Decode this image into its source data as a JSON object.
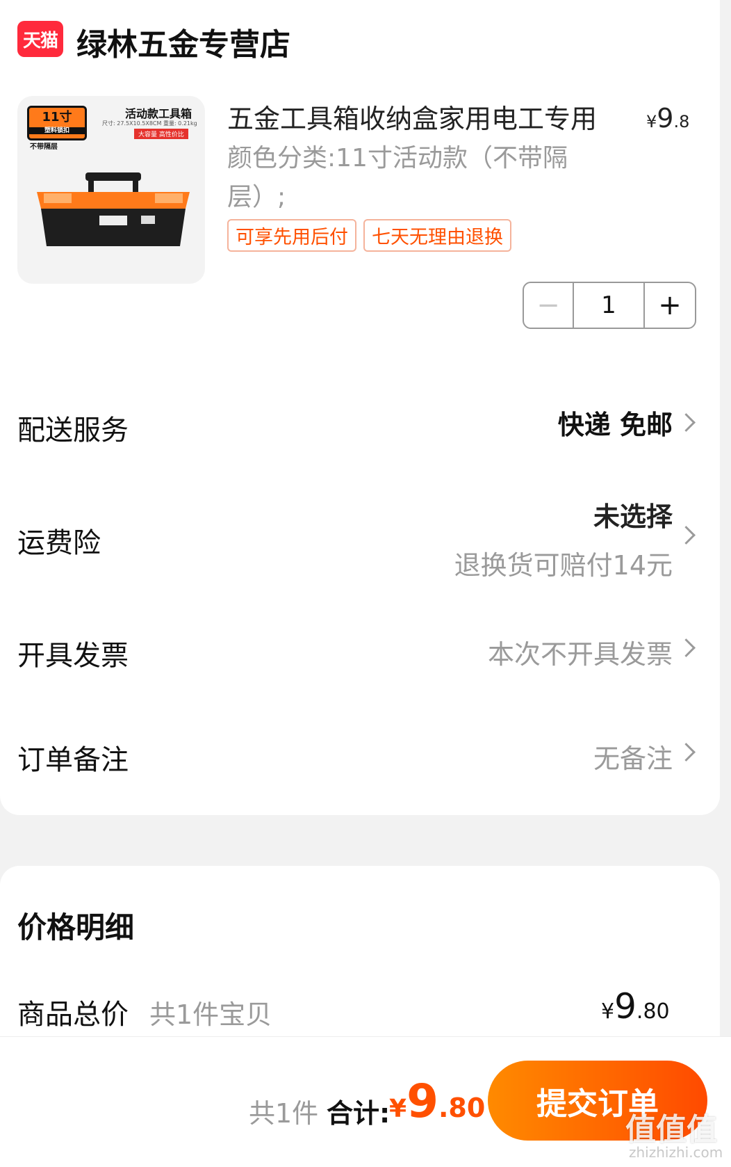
{
  "store": {
    "badge": "天猫",
    "name": "绿林五金专营店"
  },
  "product": {
    "title": "五金工具箱收纳盒家用电工专用",
    "price_symbol": "¥",
    "price_int": "9",
    "price_dec": ".8",
    "spec": "颜色分类:11寸活动款（不带隔层）;",
    "image": {
      "size_tag": "11寸",
      "size_sub": "塑料锁扣",
      "title": "活动款工具箱",
      "spec_line": "尺寸: 27.5X10.5X8CM  重量: 0.21kg",
      "red_tag": "大容量 高性价比",
      "note": "不带隔层",
      "colors": {
        "orange": "#ff7a1a",
        "black": "#1e1e1e"
      }
    },
    "tags": [
      "可享先用后付",
      "七天无理由退换"
    ],
    "quantity": "1",
    "minus": "−",
    "plus": "+"
  },
  "rows": {
    "delivery": {
      "label": "配送服务",
      "value": "快递 免邮"
    },
    "insurance": {
      "label": "运费险",
      "value": "未选择",
      "sub": "退换货可赔付14元"
    },
    "invoice": {
      "label": "开具发票",
      "value": "本次不开具发票"
    },
    "remark": {
      "label": "订单备注",
      "value": "无备注"
    }
  },
  "price_detail": {
    "title": "价格明细",
    "goods_label": "商品总价",
    "goods_count": "共1件宝贝",
    "symbol": "¥",
    "int": "9",
    "dec": ".80"
  },
  "bottom": {
    "count": "共1件",
    "total_label": "合计:",
    "symbol": "¥",
    "int": "9",
    "dec": ".80",
    "submit": "提交订单",
    "watermark": "值值值",
    "watermark_sub": "zhizhizhi.com"
  },
  "colors": {
    "accent": "#ff5000",
    "tmall_red": "#ff2a3c",
    "button_gradient_start": "#ff8a00",
    "button_gradient_end": "#ff4a00"
  }
}
